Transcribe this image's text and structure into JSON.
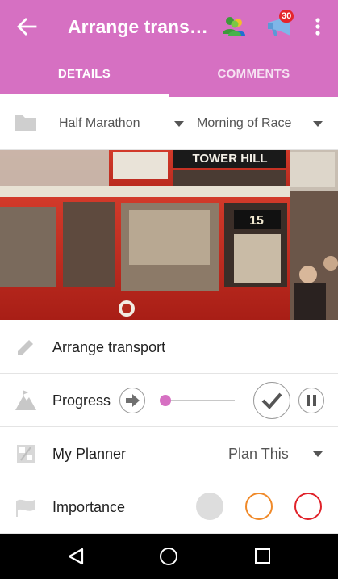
{
  "app_bar": {
    "title": "Arrange transp...",
    "notification_count": "30",
    "accent_color": "#d670c2"
  },
  "tabs": [
    {
      "label": "DETAILS",
      "selected": true
    },
    {
      "label": "COMMENTS",
      "selected": false
    }
  ],
  "folder_row": {
    "icon": "folder-icon",
    "event_dropdown": "Half Marathon",
    "time_dropdown": "Morning of Race"
  },
  "photo": {
    "sign_text": "TOWER HILL",
    "route_number": "15"
  },
  "task": {
    "icon": "pencil-icon",
    "name": "Arrange transport"
  },
  "progress": {
    "icon": "mountain-icon",
    "label": "Progress",
    "value_percent": 2
  },
  "planner": {
    "icon": "planner-icon",
    "label": "My Planner",
    "value": "Plan This"
  },
  "importance": {
    "icon": "flag-icon",
    "label": "Importance",
    "levels": [
      {
        "name": "low",
        "color": "#dddddd"
      },
      {
        "name": "medium",
        "color": "#f08a2a"
      },
      {
        "name": "high",
        "color": "#e0222a"
      }
    ]
  }
}
